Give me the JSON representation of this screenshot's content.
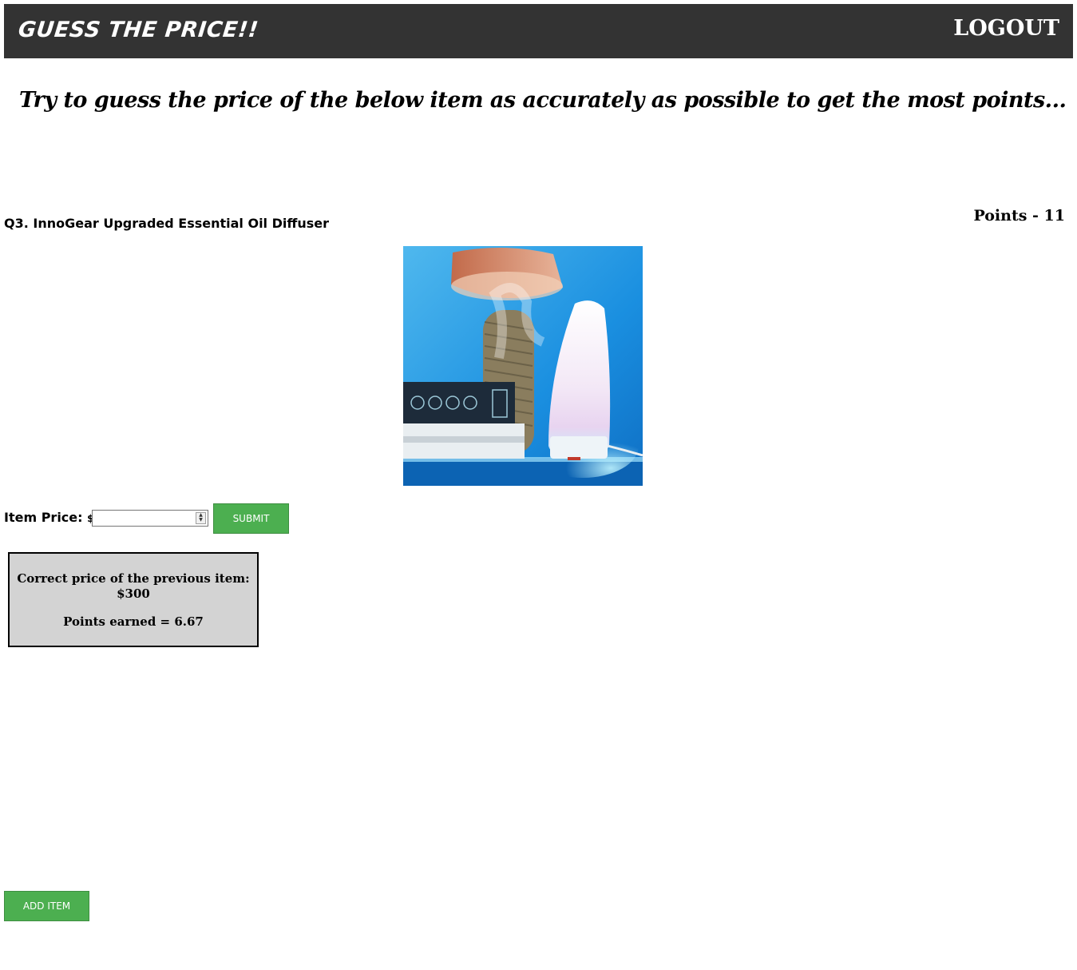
{
  "header": {
    "brand": "GUESS THE PRICE!!",
    "logout_label": "LOGOUT",
    "background": "#333333"
  },
  "intro_text": "Try to guess the price of the below item as accurately as possible to get the most points...",
  "question": {
    "title": "Q3. InnoGear Upgraded Essential Oil Diffuser",
    "image_description": "essential oil diffuser photo"
  },
  "points_text": "Points - 11",
  "form": {
    "price_label": "Item Price:",
    "currency": "$",
    "price_value": "",
    "submit_label": "SUBMIT"
  },
  "result": {
    "line1": "Correct price of the previous item:",
    "line2": "$300",
    "line3": "Points earned = 6.67"
  },
  "add_item_label": "ADD ITEM",
  "colors": {
    "button_green": "#4caf50",
    "result_bg": "#d3d3d3"
  }
}
